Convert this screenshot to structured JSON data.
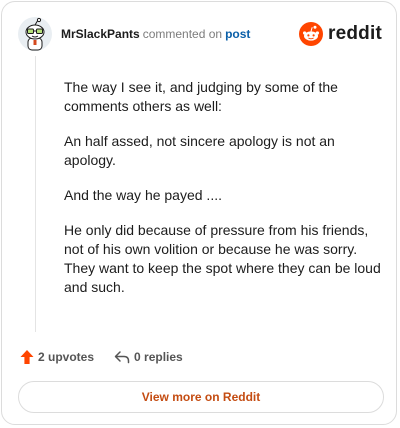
{
  "header": {
    "username": "MrSlackPants",
    "action": "commented on",
    "post_link": "post",
    "brand": "reddit"
  },
  "comment": {
    "paragraphs": [
      "The way I see it, and judging by some of the comments others as well:",
      "An half assed, not sincere apology is not an apology.",
      "And the way he payed ....",
      "He only did because of pressure from his friends, not of his own volition or because he was sorry. They want to keep the spot where they can be loud and such."
    ]
  },
  "footer": {
    "upvotes": "2 upvotes",
    "replies": "0 replies"
  },
  "view_button": "View more on Reddit",
  "colors": {
    "brand_orange": "#ff4500",
    "upvote_orange": "#ff4500",
    "link_blue": "#0a5fa8",
    "button_text": "#c44c12"
  },
  "icons": {
    "avatar": "snoo-avatar-icon",
    "brand": "reddit-logo-icon",
    "upvote": "upvote-arrow-icon",
    "reply": "reply-arrow-icon"
  }
}
